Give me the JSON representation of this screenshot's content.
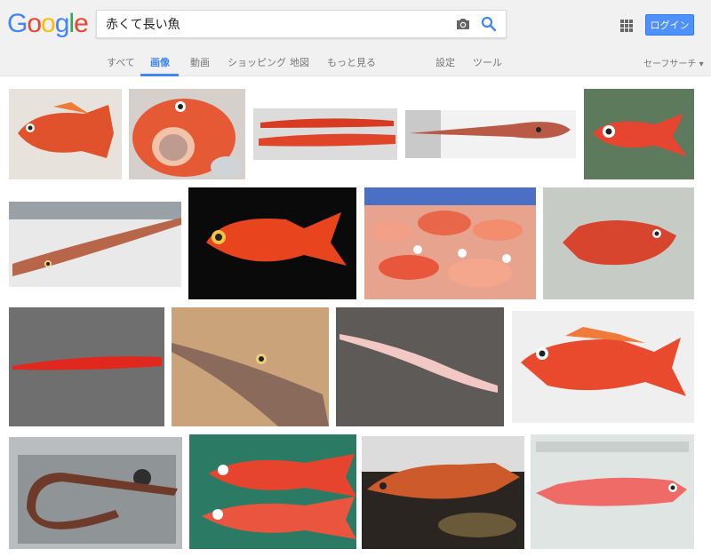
{
  "logo": {
    "letters": [
      "G",
      "o",
      "o",
      "g",
      "l",
      "e"
    ]
  },
  "search": {
    "value": "赤くて長い魚"
  },
  "header": {
    "login_label": "ログイン"
  },
  "tabs": [
    {
      "label": "すべて",
      "active": false
    },
    {
      "label": "画像",
      "active": true
    },
    {
      "label": "動画",
      "active": false
    },
    {
      "label": "ショッピング",
      "active": false
    },
    {
      "label": "地図",
      "active": false
    },
    {
      "label": "もっと見る",
      "active": false
    },
    {
      "label": "設定",
      "active": false
    },
    {
      "label": "ツール",
      "active": false
    }
  ],
  "safesearch_label": "セーフサーチ ▾",
  "colors": {
    "accent": "#4285f4",
    "login_bg": "#4d90fe"
  },
  "results": [
    {
      "subject": "red fish on white plate"
    },
    {
      "subject": "red rockfish open mouth"
    },
    {
      "subject": "red eel pair on tray"
    },
    {
      "subject": "cornetfish on white tray"
    },
    {
      "subject": "red fish on green tiles"
    },
    {
      "subject": "cornetfish close-up"
    },
    {
      "subject": "splendid alfonsino on black"
    },
    {
      "subject": "pile of red fish in crate"
    },
    {
      "subject": "red rockfish on tiles"
    },
    {
      "subject": "red bandfish on gravel"
    },
    {
      "subject": "cornetfish head on board"
    },
    {
      "subject": "pink eel on concrete"
    },
    {
      "subject": "rockfish with label"
    },
    {
      "subject": "brown eel in sink"
    },
    {
      "subject": "red snappers on green net"
    },
    {
      "subject": "grouper on ice"
    },
    {
      "subject": "red fish on ice"
    }
  ]
}
